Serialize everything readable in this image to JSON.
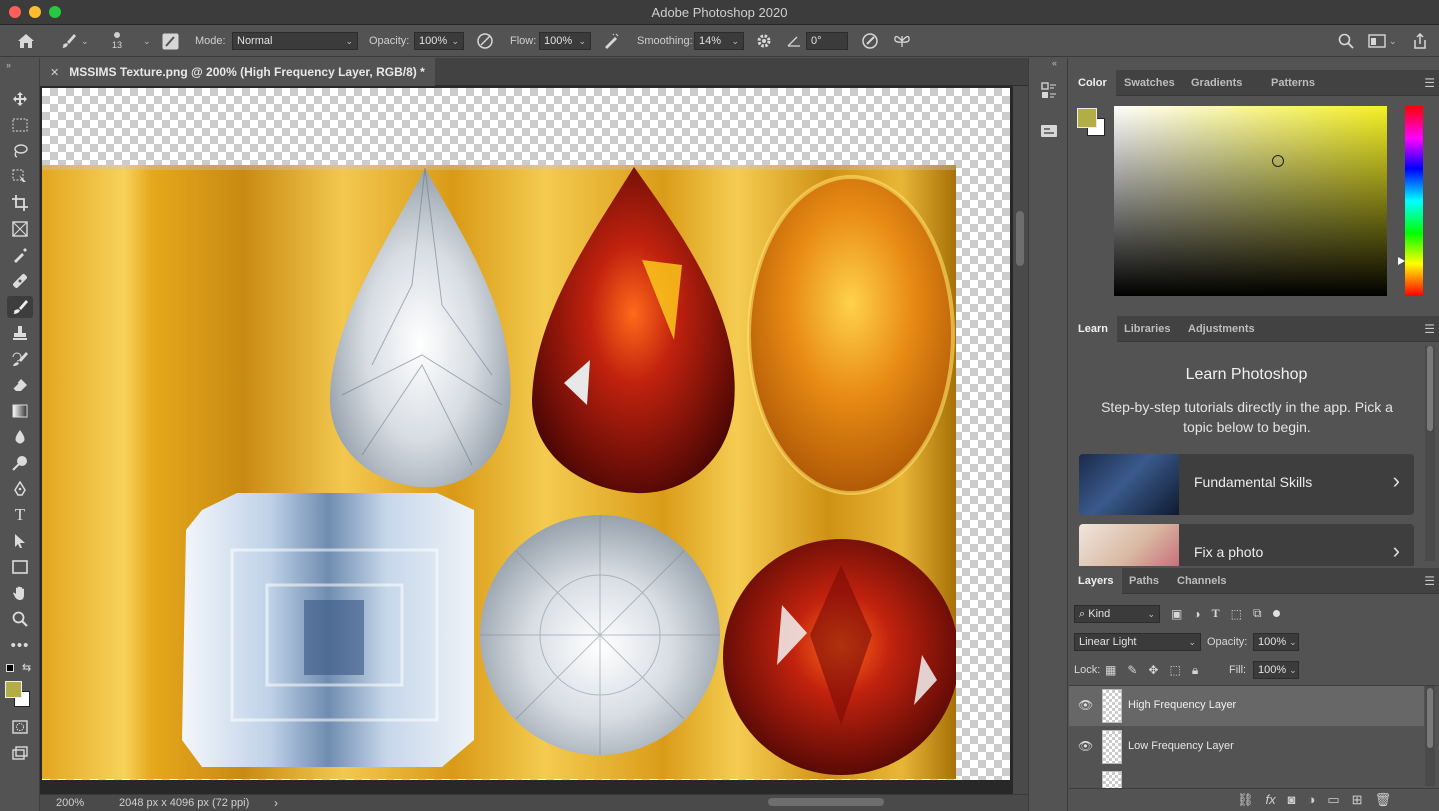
{
  "window": {
    "title": "Adobe Photoshop 2020"
  },
  "options_bar": {
    "brush_size": "13",
    "mode_label": "Mode:",
    "mode_value": "Normal",
    "opacity_label": "Opacity:",
    "opacity_value": "100%",
    "flow_label": "Flow:",
    "flow_value": "100%",
    "smoothing_label": "Smoothing:",
    "smoothing_value": "14%",
    "angle_value": "0°"
  },
  "document": {
    "tab_title": "MSSIMS Texture.png @ 200% (High Frequency Layer, RGB/8) *",
    "zoom": "200%",
    "doc_info": "2048 px x 4096 px (72 ppi)"
  },
  "color_panel": {
    "tabs": [
      "Color",
      "Swatches",
      "Gradients",
      "Patterns"
    ],
    "foreground": "#b3ad45",
    "background": "#ffffff"
  },
  "learn_panel": {
    "tabs": [
      "Learn",
      "Libraries",
      "Adjustments"
    ],
    "heading": "Learn Photoshop",
    "description": "Step-by-step tutorials directly in the app. Pick a topic below to begin.",
    "cards": [
      {
        "title": "Fundamental Skills",
        "icon": "chevron-right-icon"
      },
      {
        "title": "Fix a photo",
        "icon": "chevron-right-icon"
      }
    ]
  },
  "layers_panel": {
    "tabs": [
      "Layers",
      "Paths",
      "Channels"
    ],
    "filter_kind": "Kind",
    "blend_mode": "Linear Light",
    "opacity_label": "Opacity:",
    "opacity_value": "100%",
    "lock_label": "Lock:",
    "fill_label": "Fill:",
    "fill_value": "100%",
    "layers": [
      {
        "name": "High Frequency Layer",
        "selected": true,
        "visible": true
      },
      {
        "name": "Low Frequency Layer",
        "selected": false,
        "visible": true
      }
    ]
  }
}
